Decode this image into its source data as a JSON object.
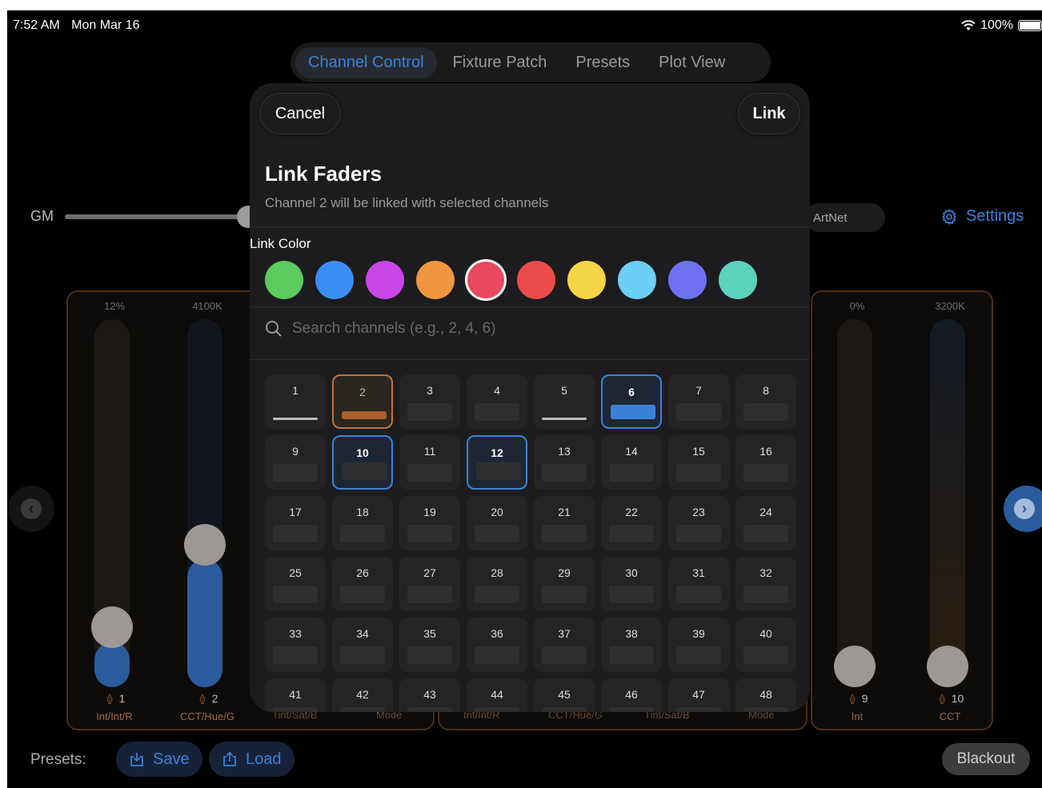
{
  "status": {
    "time": "7:52 AM",
    "date": "Mon Mar 16",
    "battery": "100%"
  },
  "tabs": [
    "Channel Control",
    "Fixture Patch",
    "Presets",
    "Plot View"
  ],
  "active_tab": 0,
  "gm_label": "GM",
  "artnet_label": "ArtNet",
  "settings_label": "Settings",
  "faders_left": [
    {
      "value": "12%",
      "number": "1",
      "mode": "Int/Int/R"
    },
    {
      "value": "4100K",
      "number": "2",
      "mode": "CCT/Hue/G"
    }
  ],
  "faders_right": [
    {
      "value": "0%",
      "number": "9",
      "mode": "Int"
    },
    {
      "value": "3200K",
      "number": "10",
      "mode": "CCT"
    }
  ],
  "obscured_modes": [
    "Tint/Sat/B",
    "Mode",
    "Int/Int/R",
    "CCT/Hue/G",
    "Tint/Sat/B",
    "Mode"
  ],
  "presets": {
    "label": "Presets:",
    "save": "Save",
    "load": "Load"
  },
  "blackout_label": "Blackout",
  "modal": {
    "cancel": "Cancel",
    "link": "Link",
    "title": "Link Faders",
    "subtitle": "Channel 2 will be linked with selected channels",
    "link_color_label": "Link Color",
    "colors": [
      "#5ccb5f",
      "#3a8ef5",
      "#c845e6",
      "#f0963f",
      "#e9485f",
      "#ea4d4a",
      "#f6d548",
      "#6dcff6",
      "#6e72f0",
      "#5bd3bf"
    ],
    "selected_color": 4,
    "search_placeholder": "Search channels (e.g., 2, 4, 6)",
    "current_channel": 2,
    "selected_channels": [
      6,
      10,
      12
    ],
    "line_channels": [
      1,
      5
    ],
    "channels": [
      "1",
      "2",
      "3",
      "4",
      "5",
      "6",
      "7",
      "8",
      "9",
      "10",
      "11",
      "12",
      "13",
      "14",
      "15",
      "16",
      "17",
      "18",
      "19",
      "20",
      "21",
      "22",
      "23",
      "24",
      "25",
      "26",
      "27",
      "28",
      "29",
      "30",
      "31",
      "32",
      "33",
      "34",
      "35",
      "36",
      "37",
      "38",
      "39",
      "40",
      "41",
      "42",
      "43",
      "44",
      "45",
      "46",
      "47",
      "48"
    ]
  }
}
